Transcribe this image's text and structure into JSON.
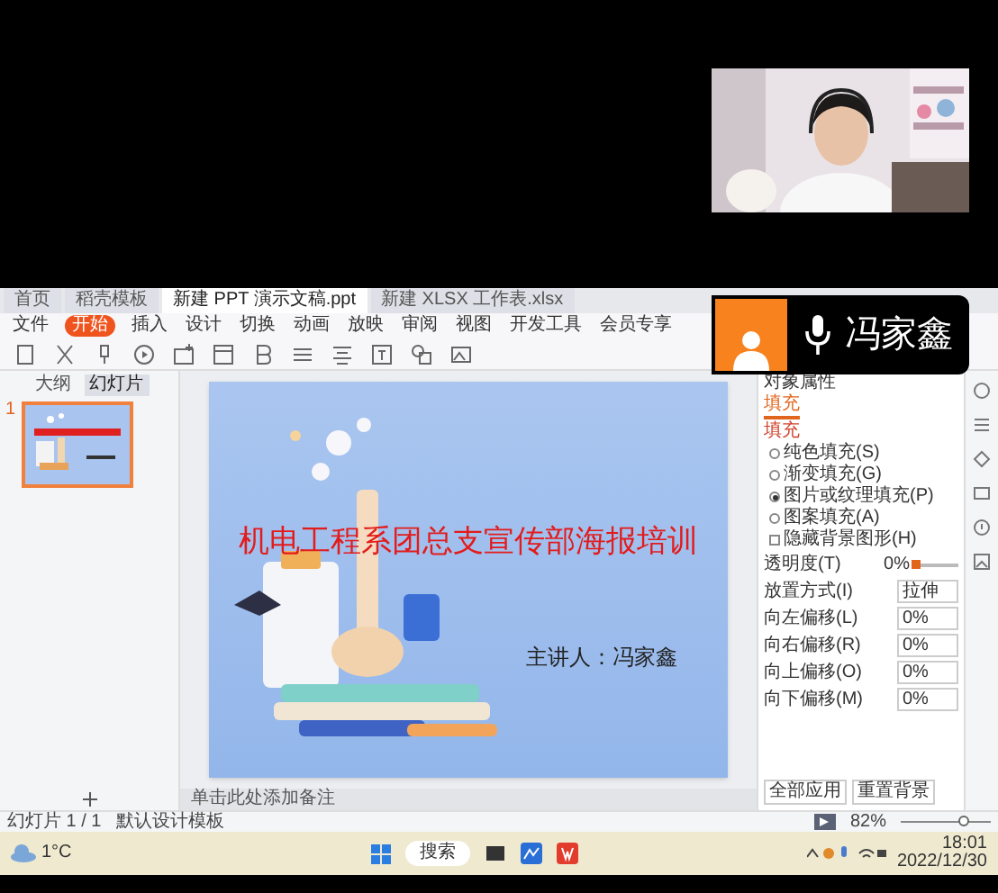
{
  "call": {
    "participant_name": "冯家鑫"
  },
  "app": {
    "tabs": [
      {
        "label": "首页",
        "selected": false
      },
      {
        "label": "稻壳模板",
        "selected": false
      },
      {
        "label": "新建 PPT 演示文稿.ppt",
        "selected": true
      },
      {
        "label": "新建 XLSX 工作表.xlsx",
        "selected": false
      }
    ],
    "menu": [
      {
        "label": "文件",
        "selected": false
      },
      {
        "label": "开始",
        "selected": true
      },
      {
        "label": "插入",
        "selected": false
      },
      {
        "label": "设计",
        "selected": false
      },
      {
        "label": "切换",
        "selected": false
      },
      {
        "label": "动画",
        "selected": false
      },
      {
        "label": "放映",
        "selected": false
      },
      {
        "label": "审阅",
        "selected": false
      },
      {
        "label": "视图",
        "selected": false
      },
      {
        "label": "开发工具",
        "selected": false
      },
      {
        "label": "会员专享",
        "selected": false
      }
    ],
    "slide_panel": {
      "tabs": [
        {
          "label": "大纲",
          "selected": false
        },
        {
          "label": "幻灯片",
          "selected": true
        }
      ],
      "thumbnails": [
        {
          "number": "1",
          "selected": true
        }
      ]
    },
    "slide": {
      "title": "机电工程系团总支宣传部海报培训",
      "presenter": "主讲人：冯家鑫"
    },
    "notes_placeholder": "单击此处添加备注",
    "properties": {
      "title": "对象属性",
      "tab": "填充",
      "section": "填充",
      "options": [
        {
          "label": "纯色填充(S)",
          "kind": "radio",
          "selected": false
        },
        {
          "label": "渐变填充(G)",
          "kind": "radio",
          "selected": false
        },
        {
          "label": "图片或纹理填充(P)",
          "kind": "radio",
          "selected": true
        },
        {
          "label": "图案填充(A)",
          "kind": "radio",
          "selected": false
        },
        {
          "label": "隐藏背景图形(H)",
          "kind": "checkbox",
          "selected": false
        }
      ],
      "rows": [
        {
          "label": "透明度(T)",
          "kind": "slider",
          "level": 0,
          "reading": "0%"
        },
        {
          "label": "放置方式(I)",
          "kind": "dropdown",
          "value": "拉伸"
        },
        {
          "label": "向左偏移(L)",
          "kind": "spin",
          "value": "0%"
        },
        {
          "label": "向右偏移(R)",
          "kind": "spin",
          "value": "0%"
        },
        {
          "label": "向上偏移(O)",
          "kind": "spin",
          "value": "0%"
        },
        {
          "label": "向下偏移(M)",
          "kind": "spin",
          "value": "0%"
        }
      ],
      "buttons": [
        "全部应用",
        "重置背景"
      ]
    },
    "status_bar": {
      "slide_count": "幻灯片 1 / 1",
      "theme": "默认设计模板",
      "zoom": "82%",
      "zoom_slider": {
        "level": 0.72
      }
    }
  },
  "taskbar": {
    "weather": "1°C",
    "search": "搜索",
    "time": "18:01",
    "date": "2022/12/30"
  }
}
